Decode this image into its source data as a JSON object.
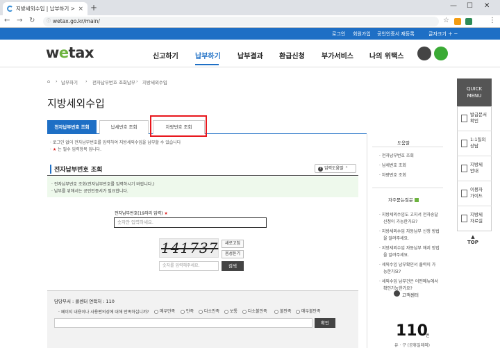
{
  "browser": {
    "tab_title": "지방세외수입 | 납부하기 > 전자",
    "tab_close": "×",
    "new_tab": "+",
    "url": "wetax.go.kr/main/",
    "win_min": "—",
    "win_max": "☐",
    "win_close": "✕"
  },
  "utility_bar": {
    "login": "로그인",
    "join": "회원가입",
    "cert": "공인인증서 재등록",
    "font_size": "글자크기 ＋ ─"
  },
  "header": {
    "logo_w": "w",
    "logo_e": "e",
    "logo_rest": "tax",
    "nav": [
      "신고하기",
      "납부하기",
      "납부결과",
      "환급신청",
      "부가서비스",
      "나의 위택스"
    ]
  },
  "breadcrumb": [
    "납부하기",
    "전자납부번호 조회납부",
    "지방세외수입"
  ],
  "page_title": "지방세외수입",
  "tabs": [
    "전자납부번호 조회",
    "납세번호 조회",
    "차량번호 조회"
  ],
  "notices": [
    "로그인 없이 전자납부번호를 입력하여 지방세외수입을 납부할 수 있습니다",
    "는 필수 입력항목 입니다."
  ],
  "section": {
    "title": "전자납부번호 조회",
    "help_btn": "입력도움말 ⌃",
    "info": [
      "· 전자납부번호 조회(전자납부번호를 입력하시기 바랍니다.)",
      "· 납부를 위해서는 공인인증서가 필요합니다."
    ],
    "field_label": "전자납부번호(19자리 입력)",
    "field_placeholder": "숫자만 입력하세요.",
    "captcha_text": "141737",
    "refresh_btn": "새로고침",
    "audio_btn": "음성듣기",
    "captcha_placeholder": "숫자를 입력해주세요.",
    "search_btn": "검색"
  },
  "survey": {
    "head": "담당부서 : 콜센터   연락처 : 110",
    "question": "페이지 내용이나 사용편의성에 대해 만족하십니까?",
    "options": [
      "매우만족",
      "만족",
      "다소만족",
      "보통",
      "다소불만족",
      "불만족",
      "매우불만족"
    ],
    "submit": "확인"
  },
  "right_side": {
    "help_title": "도움말",
    "help_links": [
      "전자납부번호 조회",
      "납세번호 조회",
      "차량번호 조회"
    ],
    "faq_title": "자주묻는질문",
    "faq_links": [
      "지방세외수입도 고지서 전자송달",
      "신청이 가능한가요?",
      "지방세외수입 자동납부 신청 방법",
      "을 알려주세요.",
      "지방세외수입 자동납부 해지 방법",
      "을 알려주세요.",
      "세외수입 납부확인서 출력이 가",
      "능한가요?",
      "세외수입 납부건은 어떤메뉴에서",
      "확인가능한가요?"
    ],
    "call_title": "고객센터",
    "call_number": "110",
    "call_unit": "번",
    "call_sub": "유 · 구 (공휴일제외)"
  },
  "quick_menu": {
    "title_1": "QUICK",
    "title_2": "MENU",
    "items": [
      "발급문서\n확인",
      "1:1질의\n상담",
      "지방세\n안내",
      "이용자\n가이드",
      "지방세\n자료실"
    ],
    "top": "TOP"
  },
  "colors": {
    "primary": "#1e6fc5",
    "highlight_box": "#e8161c",
    "logo_accent": "#6db33f"
  }
}
